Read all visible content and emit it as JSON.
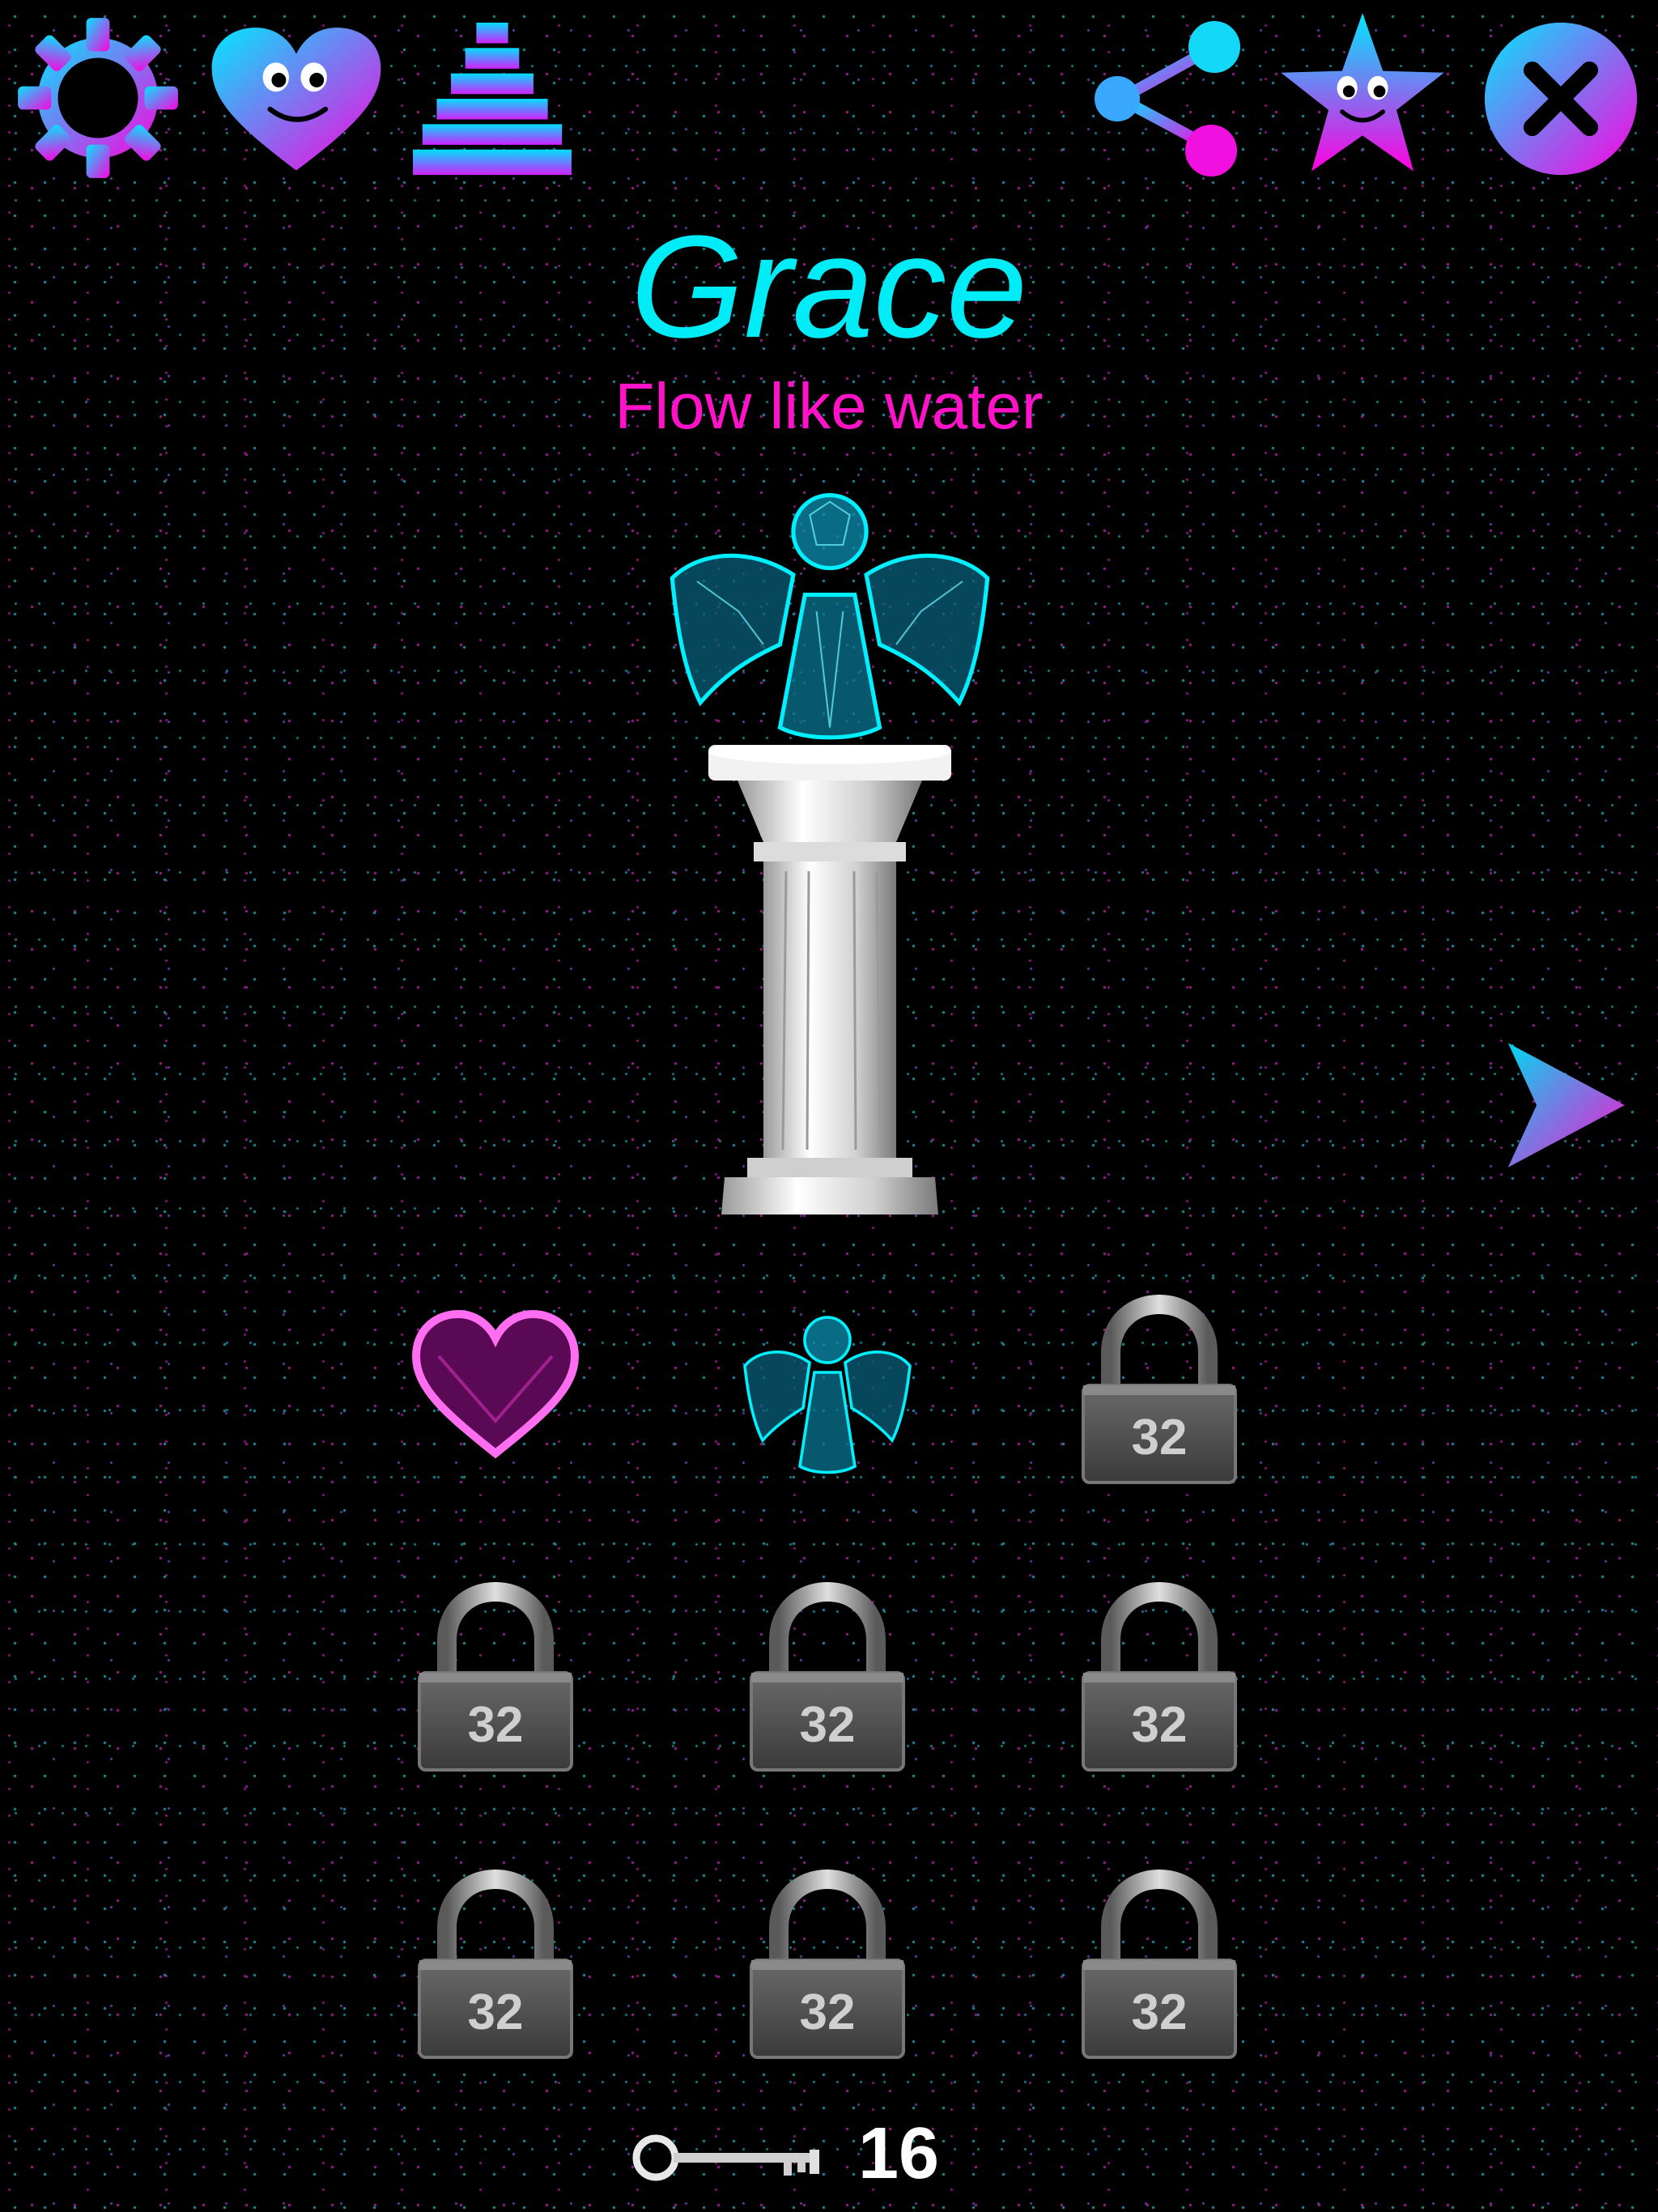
{
  "header": {
    "icons": [
      "gear-icon",
      "heart-face-icon",
      "stack-icon",
      "share-icon",
      "star-face-icon",
      "close-icon"
    ]
  },
  "character": {
    "name": "Grace",
    "tagline": "Flow like water"
  },
  "colors": {
    "accent_cyan": "#00ecf6",
    "accent_magenta": "#ff12c8",
    "lock_gray": "#555555"
  },
  "collection": {
    "items": [
      {
        "type": "heart",
        "icon": "heart-gem-icon"
      },
      {
        "type": "angel",
        "icon": "angel-icon"
      },
      {
        "type": "locked",
        "cost": "32"
      },
      {
        "type": "locked",
        "cost": "32"
      },
      {
        "type": "locked",
        "cost": "32"
      },
      {
        "type": "locked",
        "cost": "32"
      },
      {
        "type": "locked",
        "cost": "32"
      },
      {
        "type": "locked",
        "cost": "32"
      },
      {
        "type": "locked",
        "cost": "32"
      }
    ]
  },
  "footer": {
    "key_count": "16"
  }
}
